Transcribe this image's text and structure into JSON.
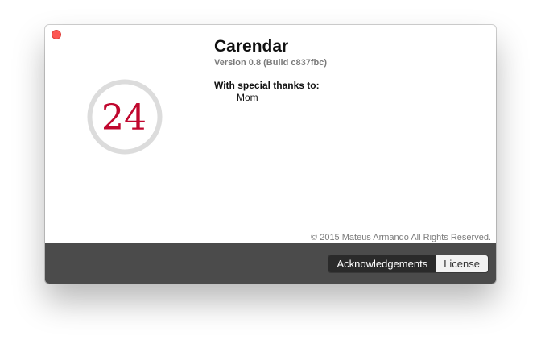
{
  "window": {
    "close_color": "#fc5753",
    "footer_color": "#4b4b4b"
  },
  "logo": {
    "number": "24",
    "number_color": "#c0072e",
    "ring_color": "#dcdcdc"
  },
  "app": {
    "name": "Carendar",
    "version": "Version 0.8 (Build c837fbc)"
  },
  "thanks": {
    "title": "With special thanks to:",
    "people": [
      "Mom"
    ]
  },
  "copyright": "© 2015 Mateus Armando All Rights Reserved.",
  "footer": {
    "tabs": [
      {
        "label": "Acknowledgements",
        "selected": true
      },
      {
        "label": "License",
        "selected": false
      }
    ]
  }
}
